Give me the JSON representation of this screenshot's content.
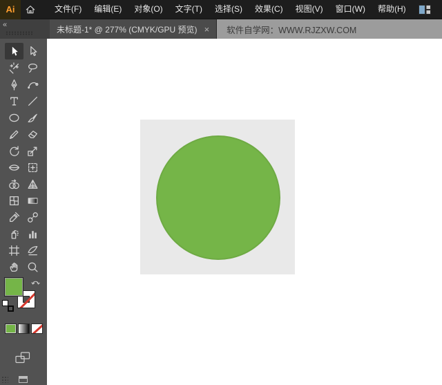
{
  "menubar": {
    "logo": "Ai",
    "items": [
      {
        "key": "file",
        "label": "文件(F)"
      },
      {
        "key": "edit",
        "label": "编辑(E)"
      },
      {
        "key": "object",
        "label": "对象(O)"
      },
      {
        "key": "type",
        "label": "文字(T)"
      },
      {
        "key": "select",
        "label": "选择(S)"
      },
      {
        "key": "effect",
        "label": "效果(C)"
      },
      {
        "key": "view",
        "label": "视图(V)"
      },
      {
        "key": "window",
        "label": "窗口(W)"
      },
      {
        "key": "help",
        "label": "帮助(H)"
      }
    ]
  },
  "tabbar": {
    "collapse": "«",
    "title": "未标题-1* @ 277% (CMYK/GPU 预览)",
    "close": "×",
    "watermark": "软件自学网：WWW.RJZXW.COM"
  },
  "toolbar": {
    "tools": [
      {
        "name": "selection-tool",
        "selected": true
      },
      {
        "name": "direct-selection-tool"
      },
      {
        "name": "magic-wand-tool"
      },
      {
        "name": "lasso-tool"
      },
      {
        "name": "pen-tool"
      },
      {
        "name": "curvature-tool"
      },
      {
        "name": "type-tool"
      },
      {
        "name": "line-segment-tool"
      },
      {
        "name": "ellipse-tool"
      },
      {
        "name": "paintbrush-tool"
      },
      {
        "name": "pencil-tool"
      },
      {
        "name": "eraser-tool"
      },
      {
        "name": "rotate-tool"
      },
      {
        "name": "scale-tool"
      },
      {
        "name": "width-tool"
      },
      {
        "name": "free-transform-tool"
      },
      {
        "name": "shape-builder-tool"
      },
      {
        "name": "perspective-grid-tool"
      },
      {
        "name": "mesh-tool"
      },
      {
        "name": "gradient-tool"
      },
      {
        "name": "eyedropper-tool"
      },
      {
        "name": "blend-tool"
      },
      {
        "name": "symbol-sprayer-tool"
      },
      {
        "name": "column-graph-tool"
      },
      {
        "name": "artboard-tool"
      },
      {
        "name": "slice-tool"
      },
      {
        "name": "hand-tool"
      },
      {
        "name": "zoom-tool"
      }
    ],
    "fill": "green",
    "stroke": "none"
  },
  "canvas": {
    "artboard_shape": "circle"
  },
  "colors": {
    "fill_green": "#75b548",
    "artboard_gray": "#e9e9e9",
    "none_red": "#d5382d",
    "brand_orange": "#ff9d2e"
  }
}
